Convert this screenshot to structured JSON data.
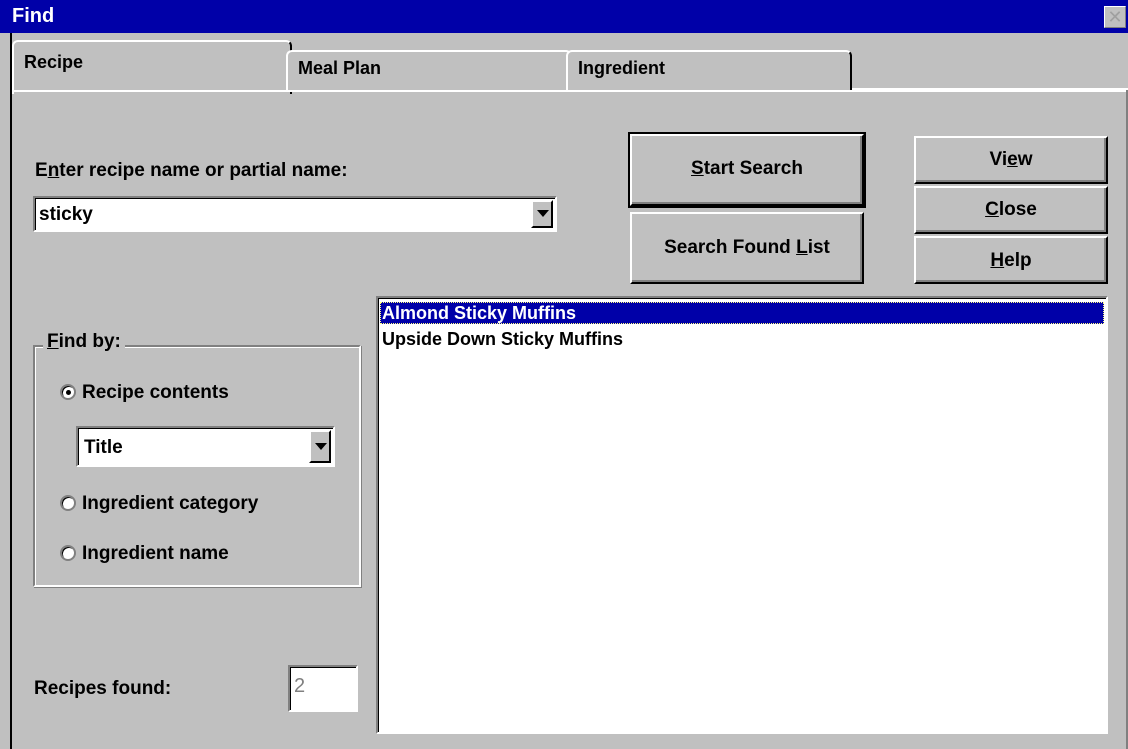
{
  "window": {
    "title": "Find",
    "close_icon": "close-icon"
  },
  "tabs": [
    {
      "label": "Recipe",
      "active": true
    },
    {
      "label": "Meal Plan",
      "active": false
    },
    {
      "label": "Ingredient",
      "active": false
    }
  ],
  "search": {
    "label_pre": "E",
    "label_mn": "n",
    "label_post": "ter recipe name or partial name:",
    "value": "sticky"
  },
  "buttons": {
    "start_search_mn": "S",
    "start_search_rest": "tart Search",
    "search_found_pre": "Search Found ",
    "search_found_mn": "L",
    "search_found_post": "ist",
    "view_pre": "Vi",
    "view_mn": "e",
    "view_post": "w",
    "close_mn": "C",
    "close_rest": "lose",
    "help_mn": "H",
    "help_rest": "elp"
  },
  "find_by": {
    "label_mn": "F",
    "label_rest": "ind by:",
    "options": [
      {
        "label": "Recipe contents",
        "selected": true
      },
      {
        "label": "Ingredient category",
        "selected": false
      },
      {
        "label": "Ingredient name",
        "selected": false
      }
    ],
    "field_value": "Title"
  },
  "results": {
    "items": [
      "Almond Sticky Muffins",
      "Upside Down Sticky Muffins"
    ],
    "selected_index": 0,
    "count_label": "Recipes found:",
    "count_value": "2"
  },
  "colors": {
    "titlebar": "#0000a8",
    "face": "#c0c0c0",
    "selection": "#0000a8"
  }
}
